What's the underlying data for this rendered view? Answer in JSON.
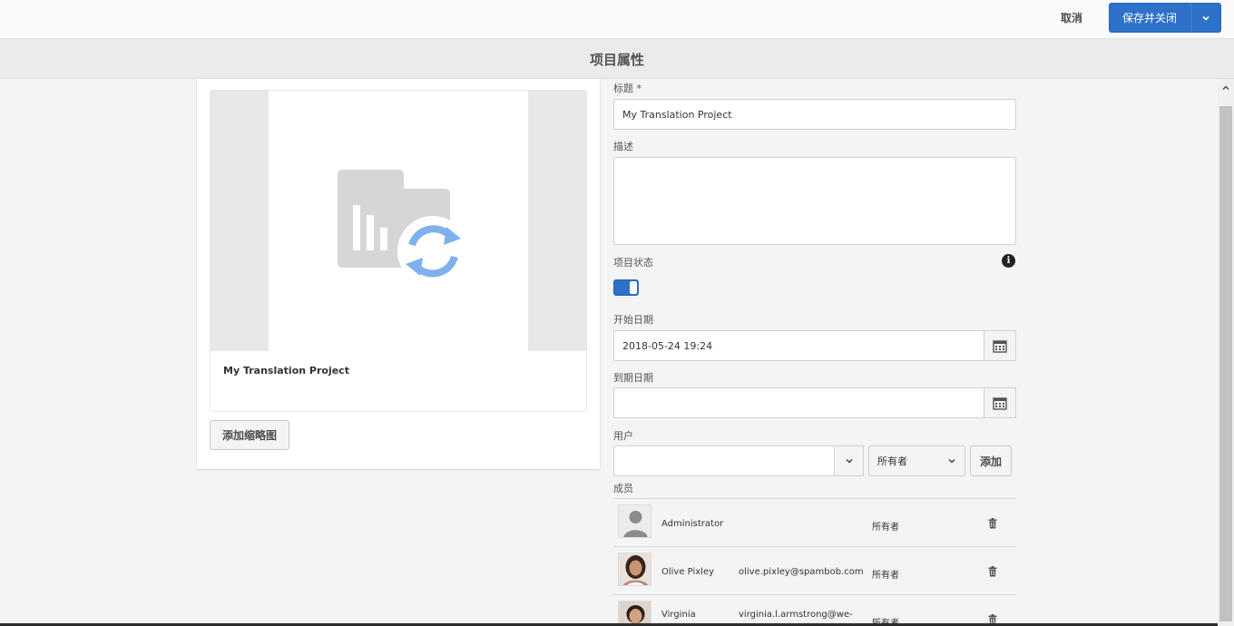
{
  "header": {
    "cancel_label": "取消",
    "save_label": "保存并关闭",
    "page_title": "项目属性"
  },
  "card": {
    "title": "My Translation Project",
    "add_thumbnail_label": "添加缩略图"
  },
  "form": {
    "title_label": "标题 *",
    "title_value": "My Translation Project",
    "description_label": "描述",
    "description_value": "",
    "status_label": "项目状态",
    "status_on": true,
    "start_date_label": "开始日期",
    "start_date_value": "2018-05-24 19:24",
    "due_date_label": "到期日期",
    "due_date_value": "",
    "user_label": "用户",
    "user_value": "",
    "role_value": "所有者",
    "add_label": "添加",
    "members_label": "成员"
  },
  "members": [
    {
      "name": "Administrator",
      "email": "",
      "role": "所有者",
      "avatar": "placeholder-person"
    },
    {
      "name": "Olive Pixley",
      "email": "olive.pixley@spambob.com",
      "role": "所有者",
      "avatar": "photo-woman-dark-hair"
    },
    {
      "name": "Virginia",
      "email": "virginia.l.armstrong@we-",
      "role": "所有者",
      "avatar": "photo-woman-short-hair"
    }
  ],
  "colors": {
    "accent": "#2d71c8",
    "icon_blue": "#7fb1ef",
    "thumb_gray": "#d6d6d6"
  }
}
